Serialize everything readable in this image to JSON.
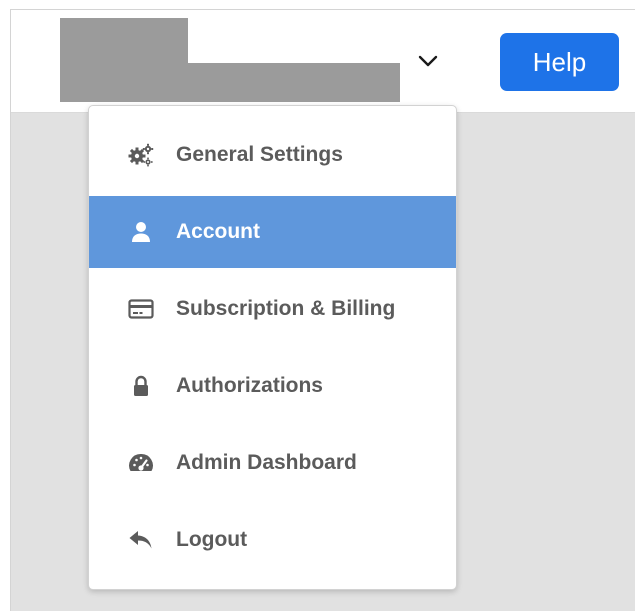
{
  "header": {
    "help_label": "Help"
  },
  "menu": {
    "items": [
      {
        "label": "General Settings",
        "icon": "gears-icon",
        "active": false
      },
      {
        "label": "Account",
        "icon": "user-icon",
        "active": true
      },
      {
        "label": "Subscription & Billing",
        "icon": "credit-card-icon",
        "active": false
      },
      {
        "label": "Authorizations",
        "icon": "lock-icon",
        "active": false
      },
      {
        "label": "Admin Dashboard",
        "icon": "speedometer-icon",
        "active": false
      },
      {
        "label": "Logout",
        "icon": "reply-arrow-icon",
        "active": false
      }
    ]
  },
  "colors": {
    "help_button": "#1e73e8",
    "active_item": "#5f97dc",
    "menu_text": "#5b5b5b",
    "backdrop": "#e1e1e1"
  }
}
